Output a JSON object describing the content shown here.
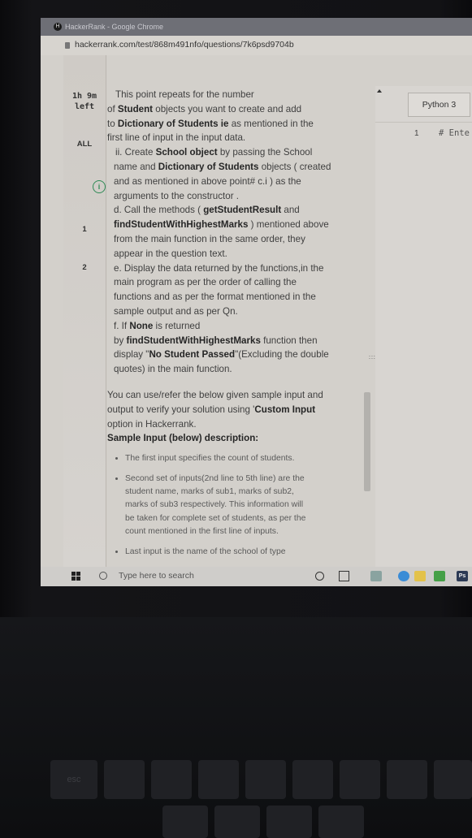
{
  "browser": {
    "title": "HackerRank - Google Chrome",
    "url": "hackerrank.com/test/868m491nfo/questions/7k6psd9704b"
  },
  "sidebar": {
    "timer": [
      "1h 9m",
      "left"
    ],
    "items": [
      "ALL",
      "i",
      "1",
      "2"
    ]
  },
  "question": {
    "lines": [
      {
        "parts": [
          {
            "t": "This point repeats for the number"
          }
        ],
        "cls": "l1"
      },
      {
        "parts": [
          {
            "t": "of "
          },
          {
            "t": "Student",
            "b": true
          },
          {
            "t": " objects you want to create and add"
          }
        ]
      },
      {
        "parts": [
          {
            "t": "to "
          },
          {
            "t": "Dictionary of Students ie",
            "b": true
          },
          {
            "t": " as mentioned in the"
          }
        ]
      },
      {
        "parts": [
          {
            "t": "first line of input in the input data."
          }
        ]
      },
      {
        "parts": [
          {
            "t": "ii. Create "
          },
          {
            "t": "School object",
            "b": true
          },
          {
            "t": " by passing the School"
          }
        ],
        "cls": "l1"
      },
      {
        "parts": [
          {
            "t": "name and "
          },
          {
            "t": "Dictionary of Students",
            "b": true
          },
          {
            "t": " objects  ( created"
          }
        ],
        "cls": "l2"
      },
      {
        "parts": [
          {
            "t": "and as mentioned in above point# c.i ) as the"
          }
        ],
        "cls": "l2"
      },
      {
        "parts": [
          {
            "t": "arguments to the constructor ."
          }
        ],
        "cls": "l2"
      },
      {
        "parts": [
          {
            "t": "d. Call the methods ( "
          },
          {
            "t": "getStudentResult",
            "b": true
          },
          {
            "t": "  and"
          }
        ],
        "cls": "l2"
      },
      {
        "parts": [
          {
            "t": "findStudentWithHighestMarks",
            "b": true
          },
          {
            "t": " ) mentioned above"
          }
        ],
        "cls": "l2"
      },
      {
        "parts": [
          {
            "t": "from the main function in the same order, they"
          }
        ],
        "cls": "l2"
      },
      {
        "parts": [
          {
            "t": "appear in the question text."
          }
        ],
        "cls": "l2"
      },
      {
        "parts": [
          {
            "t": "e. Display the data returned by the functions,in the"
          }
        ],
        "cls": "l2"
      },
      {
        "parts": [
          {
            "t": "main program as per the order of calling the"
          }
        ],
        "cls": "l2"
      },
      {
        "parts": [
          {
            "t": "functions and  as per the format mentioned in the"
          }
        ],
        "cls": "l2"
      },
      {
        "parts": [
          {
            "t": "sample output and as per Qn."
          }
        ],
        "cls": "l2"
      },
      {
        "parts": [
          {
            "t": "f. If "
          },
          {
            "t": "None",
            "b": true
          },
          {
            "t": " is returned"
          }
        ],
        "cls": "l2"
      },
      {
        "parts": [
          {
            "t": "by "
          },
          {
            "t": "findStudentWithHighestMarks",
            "b": true
          },
          {
            "t": " function then"
          }
        ],
        "cls": "l2"
      },
      {
        "parts": [
          {
            "t": "display \""
          },
          {
            "t": "No Student Passed",
            "b": true
          },
          {
            "t": "\"(Excluding the double"
          }
        ],
        "cls": "l2"
      },
      {
        "parts": [
          {
            "t": "quotes) in the main function."
          }
        ],
        "cls": "l2"
      }
    ],
    "paragraph2": [
      {
        "parts": [
          {
            "t": "You can use/refer the below given sample input and"
          }
        ]
      },
      {
        "parts": [
          {
            "t": "output to verify your solution using '"
          },
          {
            "t": "Custom Input",
            "b": true
          }
        ]
      },
      {
        "parts": [
          {
            "t": "option in Hackerrank."
          }
        ]
      },
      {
        "parts": [
          {
            "t": "Sample Input (below) description:",
            "b": true
          }
        ]
      }
    ],
    "bullets": [
      [
        "The first input specifies the count of students."
      ],
      [
        "Second set of inputs(2nd line to 5th line) are the",
        "student name, marks of sub1, marks of sub2,",
        "marks of sub3 respectively. This information will",
        "be taken for complete set of students, as per the",
        "count mentioned in the first line of inputs."
      ],
      [
        "Last input is the name of the school of type"
      ]
    ]
  },
  "editor": {
    "language": "Python 3",
    "line_number": "1",
    "code_fragment": "# Ente"
  },
  "taskbar": {
    "search_placeholder": "Type here to search",
    "ps_label": "Ps"
  },
  "colors": {
    "accent_green": "#2e8a55",
    "page_bg": "#d3d0cb"
  }
}
